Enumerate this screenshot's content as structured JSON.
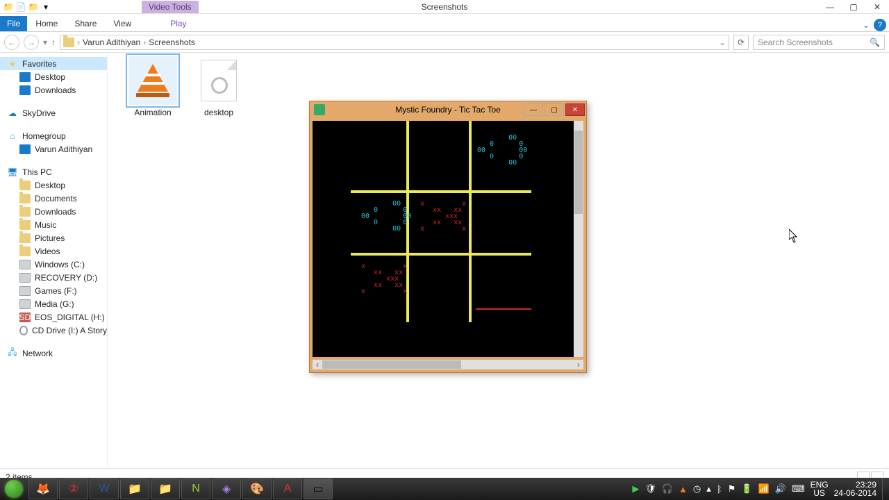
{
  "window": {
    "title": "Screenshots",
    "context_tab": "Video Tools",
    "status": "2 items"
  },
  "ribbon": {
    "file": "File",
    "tabs": [
      "Home",
      "Share",
      "View"
    ],
    "context_tabs": [
      "Play"
    ]
  },
  "breadcrumb": {
    "parts": [
      "Varun Adithiyan",
      "Screenshots"
    ]
  },
  "search": {
    "placeholder": "Search Screenshots"
  },
  "tree": {
    "favorites": {
      "label": "Favorites",
      "children": [
        "Desktop",
        "Downloads"
      ]
    },
    "skydrive": {
      "label": "SkyDrive"
    },
    "homegroup": {
      "label": "Homegroup",
      "children": [
        "Varun Adithiyan"
      ]
    },
    "thispc": {
      "label": "This PC",
      "children": [
        "Desktop",
        "Documents",
        "Downloads",
        "Music",
        "Pictures",
        "Videos",
        "Windows (C:)",
        "RECOVERY (D:)",
        "Games (F:)",
        "Media (G:)",
        "EOS_DIGITAL (H:)",
        "CD Drive (I:) A Story"
      ]
    },
    "network": {
      "label": "Network"
    }
  },
  "files": [
    {
      "name": "Animation",
      "kind": "vlc"
    },
    {
      "name": "desktop",
      "kind": "ini"
    }
  ],
  "game_window": {
    "title": "Mystic Foundry - Tic Tac Toe",
    "board": [
      [
        "",
        "",
        "O"
      ],
      [
        "O",
        "X",
        ""
      ],
      [
        "X",
        "",
        ""
      ]
    ],
    "glyph_o": "     00\n  0      0\n00        00\n  0      0\n     00",
    "glyph_x": "x         x\n  xx   xx\n    xxx\n  xx   xx\nx         x"
  },
  "taskbar": {
    "lang1": "ENG",
    "lang2": "US",
    "time": "23:29",
    "date": "24-06-2014"
  }
}
